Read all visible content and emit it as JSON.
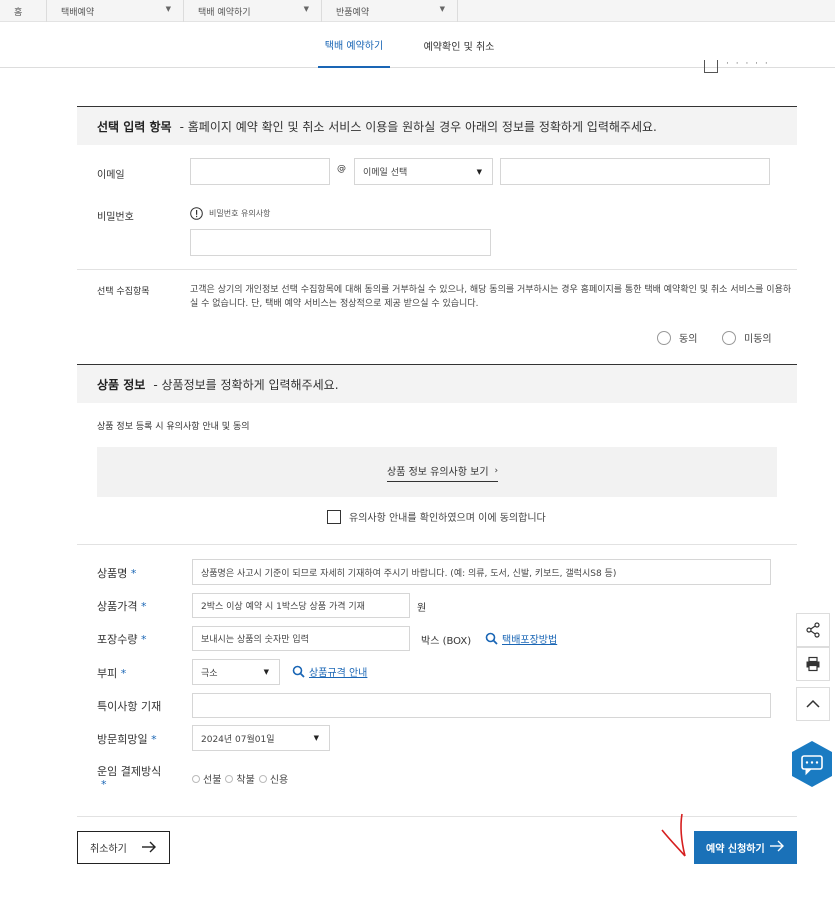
{
  "breadcrumb": {
    "home": "홈",
    "level1": "택배예약",
    "level2": "택배 예약하기",
    "level3": "반품예약"
  },
  "tabs": [
    {
      "label": "택배 예약하기",
      "active": true
    },
    {
      "label": "예약확인 및 취소",
      "active": false
    }
  ],
  "optional_section": {
    "title": "선택 입력 항목",
    "desc": "- 홈페이지 예약 확인 및 취소 서비스 이용을 원하실 경우 아래의 정보를 정확하게 입력해주세요.",
    "email_label": "이메일",
    "email_at": "@",
    "email_domain_select": "이메일 선택",
    "email_id_value": "",
    "email_domain_value": "",
    "password_label": "비밀번호",
    "password_notice": "비밀번호 유의사항",
    "password_value": "",
    "consent_label": "선택 수집항목",
    "consent_text": "고객은 상기의 개인정보 선택 수집항목에 대해 동의를 거부하실 수 있으나, 해당 동의를 거부하시는 경우 홈페이지를 통한 택배 예약확인 및 취소 서비스를 이용하실 수 없습니다. 단, 택배 예약 서비스는 정상적으로 제공 받으실 수 있습니다.",
    "agree": "동의",
    "disagree": "미동의"
  },
  "product_section": {
    "title": "상품 정보",
    "desc": "- 상품정보를 정확하게 입력해주세요.",
    "notice_heading": "상품 정보 등록 시 유의사항 안내 및 동의",
    "notice_link": "상품 정보 유의사항 보기",
    "notice_confirm": "유의사항 안내를 확인하였으며 이에 동의합니다"
  },
  "form": {
    "required_mark": "*",
    "product_name": {
      "label": "상품명",
      "placeholder": "상품명은 사고시 기준이 되므로 자세히 기재하여 주시기 바랍니다. (예: 의류, 도서, 신발, 키보드, 갤럭시S8 등)"
    },
    "product_price": {
      "label": "상품가격",
      "placeholder": "2박스 이상 예약 시 1박스당 상품 가격 기재",
      "unit": "원"
    },
    "pack_qty": {
      "label": "포장수량",
      "placeholder": "보내시는 상품의 숫자만 입력",
      "unit": "박스 (BOX)",
      "link": "택배포장방법"
    },
    "volume": {
      "label": "부피",
      "selected": "극소",
      "link": "상품규격 안내"
    },
    "special_note": {
      "label": "특이사항 기재",
      "value": ""
    },
    "visit_date": {
      "label": "방문희망일",
      "selected": "2024년 07월01일"
    },
    "payment": {
      "label": "운임 결제방식",
      "options": [
        "선불",
        "착불",
        "신용"
      ]
    }
  },
  "buttons": {
    "cancel": "취소하기",
    "submit": "예약 신청하기"
  },
  "colors": {
    "accent": "#1a71b8",
    "link": "#1a66b5",
    "annotation": "#d61f1f"
  },
  "icons": {
    "share": "share-icon",
    "print": "print-icon",
    "top": "chevron-up-icon",
    "chat": "chat-icon"
  }
}
